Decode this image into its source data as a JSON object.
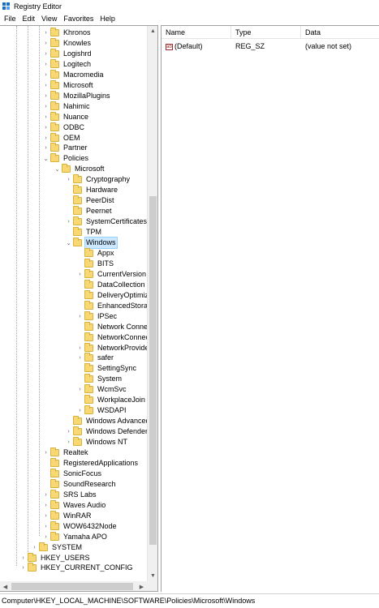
{
  "window": {
    "title": "Registry Editor"
  },
  "menu": [
    "File",
    "Edit",
    "View",
    "Favorites",
    "Help"
  ],
  "tree": [
    {
      "label": "Khronos",
      "depth": 3,
      "expander": "›"
    },
    {
      "label": "Knowles",
      "depth": 3,
      "expander": "›"
    },
    {
      "label": "Logishrd",
      "depth": 3,
      "expander": "›"
    },
    {
      "label": "Logitech",
      "depth": 3,
      "expander": "›"
    },
    {
      "label": "Macromedia",
      "depth": 3,
      "expander": "›"
    },
    {
      "label": "Microsoft",
      "depth": 3,
      "expander": "›"
    },
    {
      "label": "MozillaPlugins",
      "depth": 3,
      "expander": "›"
    },
    {
      "label": "Nahimic",
      "depth": 3,
      "expander": "›"
    },
    {
      "label": "Nuance",
      "depth": 3,
      "expander": "›"
    },
    {
      "label": "ODBC",
      "depth": 3,
      "expander": "›"
    },
    {
      "label": "OEM",
      "depth": 3,
      "expander": "›"
    },
    {
      "label": "Partner",
      "depth": 3,
      "expander": "›"
    },
    {
      "label": "Policies",
      "depth": 3,
      "expander": "⌄"
    },
    {
      "label": "Microsoft",
      "depth": 4,
      "expander": "⌄"
    },
    {
      "label": "Cryptography",
      "depth": 5,
      "expander": "›"
    },
    {
      "label": "Hardware",
      "depth": 5,
      "expander": ""
    },
    {
      "label": "PeerDist",
      "depth": 5,
      "expander": ""
    },
    {
      "label": "Peernet",
      "depth": 5,
      "expander": ""
    },
    {
      "label": "SystemCertificates",
      "depth": 5,
      "expander": "›"
    },
    {
      "label": "TPM",
      "depth": 5,
      "expander": ""
    },
    {
      "label": "Windows",
      "depth": 5,
      "expander": "⌄",
      "selected": true
    },
    {
      "label": "Appx",
      "depth": 6,
      "expander": ""
    },
    {
      "label": "BITS",
      "depth": 6,
      "expander": ""
    },
    {
      "label": "CurrentVersion",
      "depth": 6,
      "expander": "›"
    },
    {
      "label": "DataCollection",
      "depth": 6,
      "expander": ""
    },
    {
      "label": "DeliveryOptimizat",
      "depth": 6,
      "expander": ""
    },
    {
      "label": "EnhancedStorageI",
      "depth": 6,
      "expander": ""
    },
    {
      "label": "IPSec",
      "depth": 6,
      "expander": "›"
    },
    {
      "label": "Network Connect",
      "depth": 6,
      "expander": ""
    },
    {
      "label": "NetworkConnectiv",
      "depth": 6,
      "expander": ""
    },
    {
      "label": "NetworkProvider",
      "depth": 6,
      "expander": "›"
    },
    {
      "label": "safer",
      "depth": 6,
      "expander": "›"
    },
    {
      "label": "SettingSync",
      "depth": 6,
      "expander": ""
    },
    {
      "label": "System",
      "depth": 6,
      "expander": ""
    },
    {
      "label": "WcmSvc",
      "depth": 6,
      "expander": "›"
    },
    {
      "label": "WorkplaceJoin",
      "depth": 6,
      "expander": ""
    },
    {
      "label": "WSDAPI",
      "depth": 6,
      "expander": "›"
    },
    {
      "label": "Windows Advanced T",
      "depth": 5,
      "expander": ""
    },
    {
      "label": "Windows Defender",
      "depth": 5,
      "expander": "›"
    },
    {
      "label": "Windows NT",
      "depth": 5,
      "expander": "›"
    },
    {
      "label": "Realtek",
      "depth": 3,
      "expander": "›"
    },
    {
      "label": "RegisteredApplications",
      "depth": 3,
      "expander": ""
    },
    {
      "label": "SonicFocus",
      "depth": 3,
      "expander": ""
    },
    {
      "label": "SoundResearch",
      "depth": 3,
      "expander": ""
    },
    {
      "label": "SRS Labs",
      "depth": 3,
      "expander": "›"
    },
    {
      "label": "Waves Audio",
      "depth": 3,
      "expander": "›"
    },
    {
      "label": "WinRAR",
      "depth": 3,
      "expander": "›"
    },
    {
      "label": "WOW6432Node",
      "depth": 3,
      "expander": "›"
    },
    {
      "label": "Yamaha APO",
      "depth": 3,
      "expander": "›"
    },
    {
      "label": "SYSTEM",
      "depth": 2,
      "expander": "›"
    },
    {
      "label": "HKEY_USERS",
      "depth": 1,
      "expander": "›"
    },
    {
      "label": "HKEY_CURRENT_CONFIG",
      "depth": 1,
      "expander": "›"
    }
  ],
  "list": {
    "columns": [
      "Name",
      "Type",
      "Data"
    ],
    "rows": [
      {
        "name": "(Default)",
        "type": "REG_SZ",
        "data": "(value not set)",
        "icon": "string-value-icon"
      }
    ]
  },
  "status": {
    "path": "Computer\\HKEY_LOCAL_MACHINE\\SOFTWARE\\Policies\\Microsoft\\Windows"
  },
  "colors": {
    "folder": "#f8d775",
    "selection": "#cce8ff",
    "value_icon": "#9c2b2b"
  }
}
